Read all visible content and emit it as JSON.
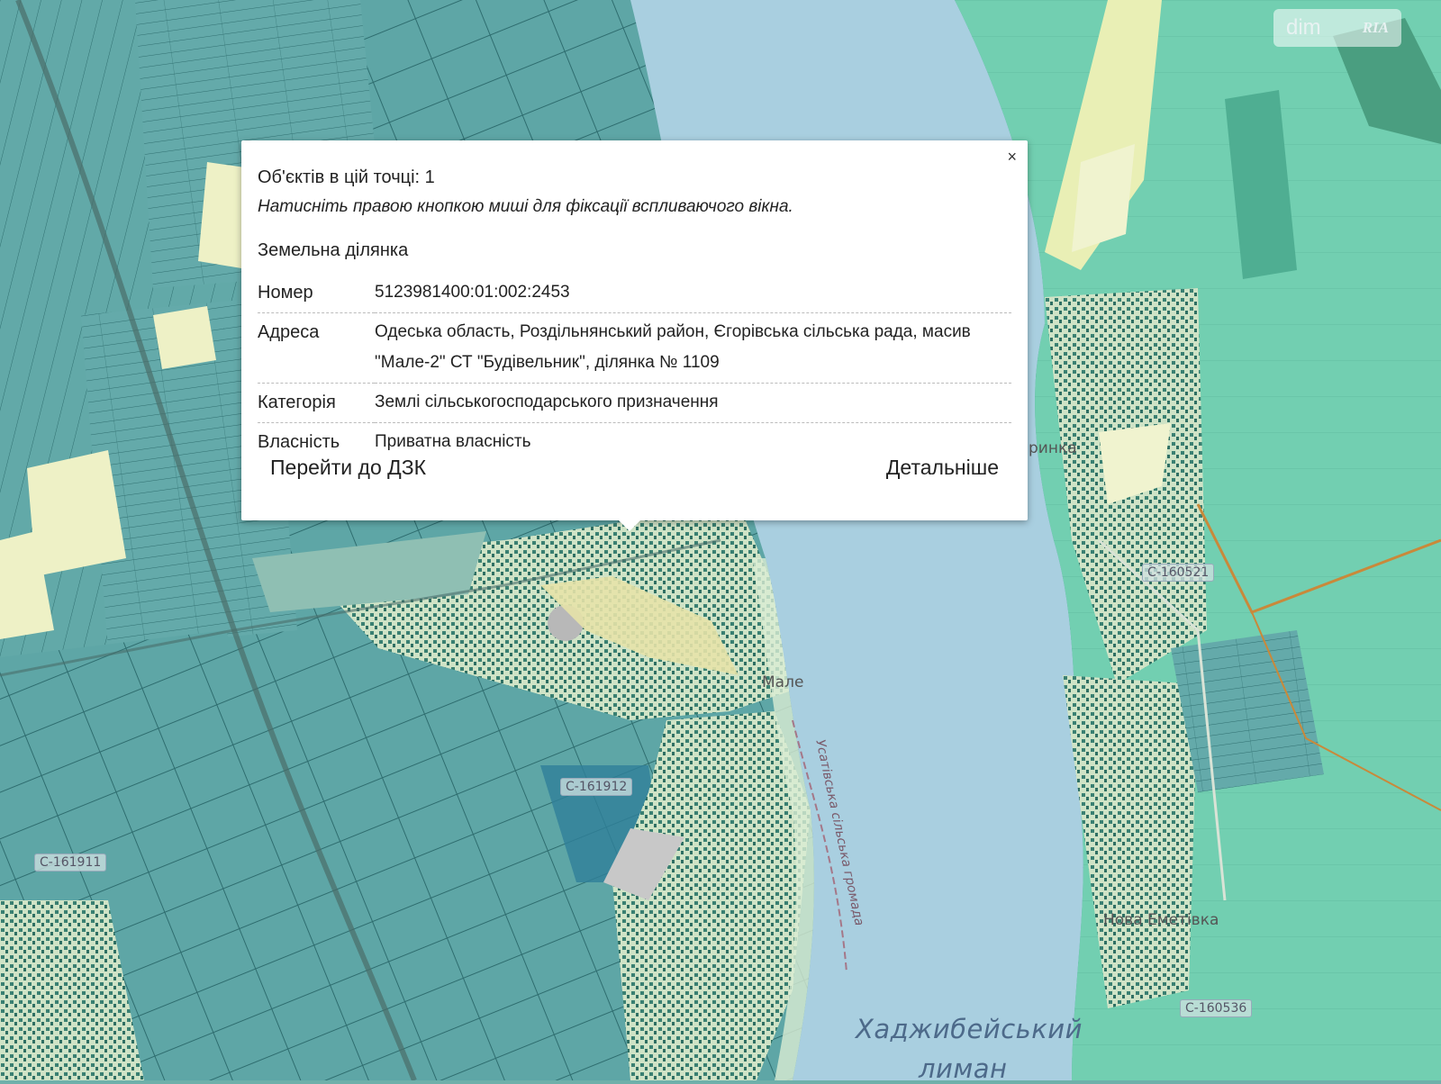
{
  "popup": {
    "count_text": "Об'єктів в цій точці: 1",
    "hint_text": "Натисніть правою кнопкою миші для фіксації вспливаючого вікна.",
    "section_title": "Земельна ділянка",
    "close_symbol": "×",
    "rows": [
      {
        "key": "Номер",
        "value": "5123981400:01:002:2453"
      },
      {
        "key": "Адреса",
        "value": "Одеська область, Роздільнянський район, Єгорівська сільська рада, масив \"Мале-2\" СТ \"Будівельник\", ділянка № 1109"
      },
      {
        "key": "Категорія",
        "value": "Землі сільськогосподарського призначення"
      },
      {
        "key": "Власність",
        "value": "Приватна власність"
      }
    ],
    "actions": {
      "dzk": "Перейти до ДЗК",
      "details": "Детальніше"
    }
  },
  "watermark": {
    "text": "dim",
    "badge": "RIA"
  },
  "map_labels": {
    "lake_line1": "Хаджибейський",
    "lake_line2": "лиман",
    "village_nova": "Нова Еметівка",
    "village_male": "Мале",
    "village_north": "ринка",
    "road_1": "С-161911",
    "road_2": "С-161912",
    "road_3": "С-160521",
    "road_4": "С-160536",
    "border_text": "Усатівська сільська громада"
  },
  "colors": {
    "water": "#a9cfe0",
    "parcel": "#5fa7a6",
    "agro": "#76d2b3",
    "field": "#eef1c6"
  }
}
